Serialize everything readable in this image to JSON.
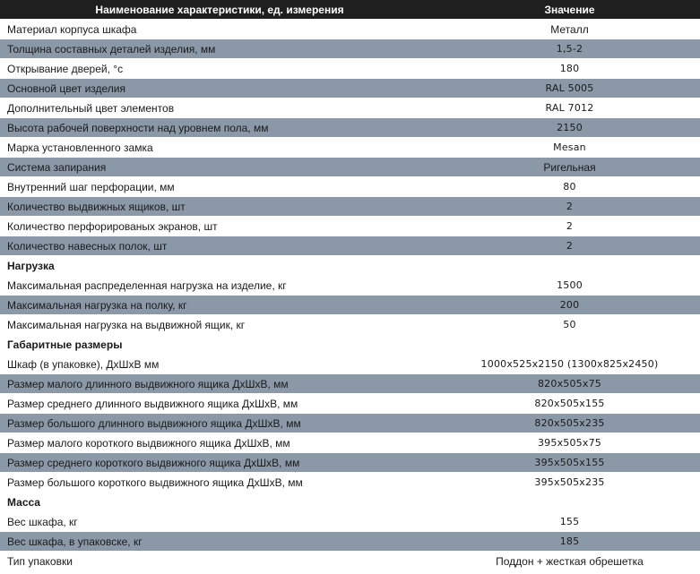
{
  "header": {
    "col_name": "Наименование характеристики, ед. измерения",
    "col_value": "Значение"
  },
  "rows": [
    {
      "type": "row",
      "name": "Материал корпуса шкафа",
      "value": "Металл"
    },
    {
      "type": "row",
      "name": "Толщина составных деталей изделия, мм",
      "value": "1,5-2"
    },
    {
      "type": "row",
      "name": "Открывание дверей, °c",
      "value": "180"
    },
    {
      "type": "row",
      "name": "Основной цвет изделия",
      "value": "RAL 5005"
    },
    {
      "type": "row",
      "name": "Дополнительный цвет элементов",
      "value": "RAL 7012"
    },
    {
      "type": "row",
      "name": "Высота рабочей поверхности над уровнем пола, мм",
      "value": "2150"
    },
    {
      "type": "row",
      "name": "Марка установленного замка",
      "value": "Mesan"
    },
    {
      "type": "row",
      "name": "Система запирания",
      "value": "Ригельная"
    },
    {
      "type": "row",
      "name": "Внутренний шаг перфорации, мм",
      "value": "80"
    },
    {
      "type": "row",
      "name": "Количество выдвижных ящиков, шт",
      "value": "2"
    },
    {
      "type": "row",
      "name": "Количество перфорированых экранов, шт",
      "value": "2"
    },
    {
      "type": "row",
      "name": "Количество навесных полок, шт",
      "value": "2"
    },
    {
      "type": "section",
      "name": "Нагрузка"
    },
    {
      "type": "row",
      "name": "Максимальная распределенная нагрузка на изделие, кг",
      "value": "1500"
    },
    {
      "type": "row",
      "name": "Максимальная нагрузка на полку, кг",
      "value": "200"
    },
    {
      "type": "row",
      "name": "Максимальная нагрузка на выдвижной ящик, кг",
      "value": "50"
    },
    {
      "type": "section",
      "name": "Габаритные размеры"
    },
    {
      "type": "row",
      "name": "Шкаф (в упаковке), ДхШхВ мм",
      "value": "1000x525x2150 (1300x825x2450)"
    },
    {
      "type": "row",
      "name": "Размер малого длинного выдвижного ящика ДхШхВ, мм",
      "value": "820x505x75"
    },
    {
      "type": "row",
      "name": "Размер среднего длинного выдвижного ящика ДхШхВ, мм",
      "value": "820x505x155"
    },
    {
      "type": "row",
      "name": "Размер большого длинного выдвижного ящика ДхШхВ, мм",
      "value": "820x505x235"
    },
    {
      "type": "row",
      "name": "Размер малого короткого выдвижного ящика ДхШхВ, мм",
      "value": "395x505x75"
    },
    {
      "type": "row",
      "name": "Размер среднего короткого выдвижного ящика ДхШхВ, мм",
      "value": "395x505x155"
    },
    {
      "type": "row",
      "name": "Размер большого короткого выдвижного ящика ДхШхВ, мм",
      "value": "395x505x235"
    },
    {
      "type": "section",
      "name": "Масса"
    },
    {
      "type": "row",
      "name": "Вес шкафа, кг",
      "value": "155"
    },
    {
      "type": "row",
      "name": "Вес шкафа, в упаковске, кг",
      "value": "185"
    },
    {
      "type": "row",
      "name": "Тип упаковки",
      "value": "Поддон + жесткая обрешетка"
    }
  ],
  "colors": {
    "header_bg": "#1f1f1f",
    "row_dark_bg": "#8a98a8",
    "row_light_bg": "#ffffff"
  }
}
